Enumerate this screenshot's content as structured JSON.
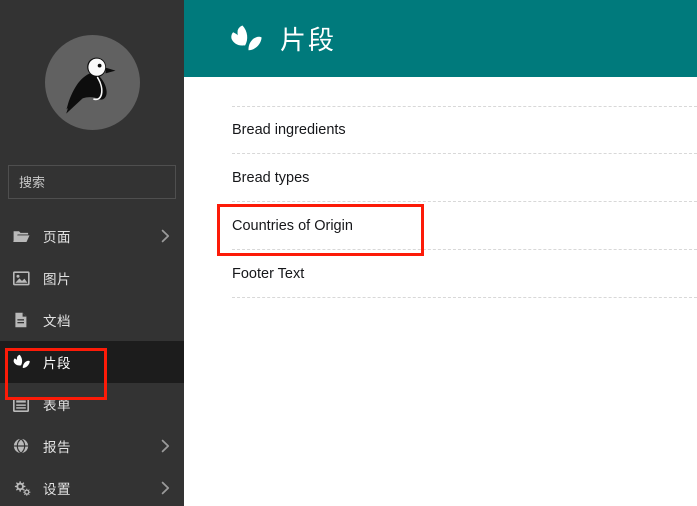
{
  "colors": {
    "header_teal": "#007a7c",
    "sidebar_bg": "#333333",
    "sidebar_active_bg": "#1c1c1c",
    "highlight_red": "#fc1b08",
    "avatar_bg": "#616161"
  },
  "sidebar": {
    "avatar_icon": "bird-logo-icon",
    "search": {
      "placeholder": "搜索",
      "value": "",
      "icon": "search-icon"
    },
    "items": [
      {
        "label": "页面",
        "icon": "folder-open-icon",
        "has_chevron": true,
        "active": false
      },
      {
        "label": "图片",
        "icon": "image-icon",
        "has_chevron": false,
        "active": false
      },
      {
        "label": "文档",
        "icon": "document-icon",
        "has_chevron": false,
        "active": false
      },
      {
        "label": "片段",
        "icon": "leaves-icon",
        "has_chevron": false,
        "active": true
      },
      {
        "label": "表单",
        "icon": "form-icon",
        "has_chevron": false,
        "active": false
      },
      {
        "label": "报告",
        "icon": "globe-icon",
        "has_chevron": true,
        "active": false
      },
      {
        "label": "设置",
        "icon": "gears-icon",
        "has_chevron": true,
        "active": false
      }
    ]
  },
  "header": {
    "icon": "leaves-icon",
    "title": "片段"
  },
  "list": {
    "items": [
      {
        "label": "Bread ingredients",
        "highlighted": false
      },
      {
        "label": "Bread types",
        "highlighted": false
      },
      {
        "label": "Countries of Origin",
        "highlighted": true
      },
      {
        "label": "Footer Text",
        "highlighted": false
      }
    ]
  },
  "highlights": [
    {
      "name": "sidebar-snippets-highlight",
      "target": "片段"
    },
    {
      "name": "list-countries-highlight",
      "target": "Countries of Origin"
    }
  ]
}
